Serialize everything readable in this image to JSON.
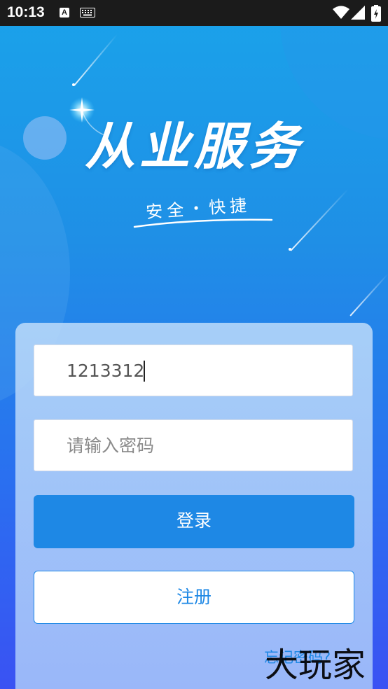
{
  "status_bar": {
    "time": "10:13",
    "icons": [
      "a-icon",
      "keyboard-icon",
      "wifi-icon",
      "signal-icon",
      "battery-icon"
    ]
  },
  "hero": {
    "title": "从业服务",
    "subtitle": "安全・快捷"
  },
  "login": {
    "username_value": "1213312",
    "password_placeholder": "请输入密码",
    "login_label": "登录",
    "register_label": "注册",
    "forgot_label": "忘记密码?"
  },
  "watermark": "大玩家",
  "colors": {
    "accent": "#1e88e5",
    "bg_top": "#1aa3ea",
    "bg_bottom": "#3a52f3"
  }
}
